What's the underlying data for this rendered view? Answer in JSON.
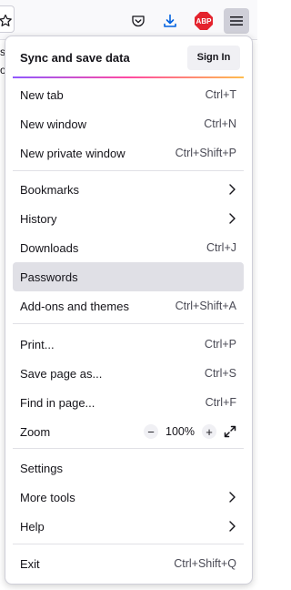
{
  "menu": {
    "sync": {
      "title": "Sync and save data",
      "sign_in": "Sign In"
    },
    "items": [
      {
        "label": "New tab",
        "shortcut": "Ctrl+T"
      },
      {
        "label": "New window",
        "shortcut": "Ctrl+N"
      },
      {
        "label": "New private window",
        "shortcut": "Ctrl+Shift+P"
      },
      {
        "label": "Bookmarks",
        "icon": "chevron-right-icon"
      },
      {
        "label": "History",
        "icon": "chevron-right-icon"
      },
      {
        "label": "Downloads",
        "shortcut": "Ctrl+J"
      },
      {
        "label": "Passwords"
      },
      {
        "label": "Add-ons and themes",
        "shortcut": "Ctrl+Shift+A"
      },
      {
        "label": "Print...",
        "shortcut": "Ctrl+P"
      },
      {
        "label": "Save page as...",
        "shortcut": "Ctrl+S"
      },
      {
        "label": "Find in page...",
        "shortcut": "Ctrl+F"
      },
      {
        "label": "Settings"
      },
      {
        "label": "More tools",
        "icon": "chevron-right-icon"
      },
      {
        "label": "Help",
        "icon": "chevron-right-icon"
      },
      {
        "label": "Exit",
        "shortcut": "Ctrl+Shift+Q"
      }
    ],
    "zoom": {
      "label": "Zoom",
      "minus": "−",
      "value": "100%",
      "plus": "+"
    }
  },
  "toolbar": {
    "abp_badge": "ABP",
    "side_text_1": "s",
    "side_text_2": "o"
  },
  "colors": {
    "hover_row": "#e0e0e6",
    "abp_red": "#e4232d",
    "download_blue": "#0061e0"
  }
}
